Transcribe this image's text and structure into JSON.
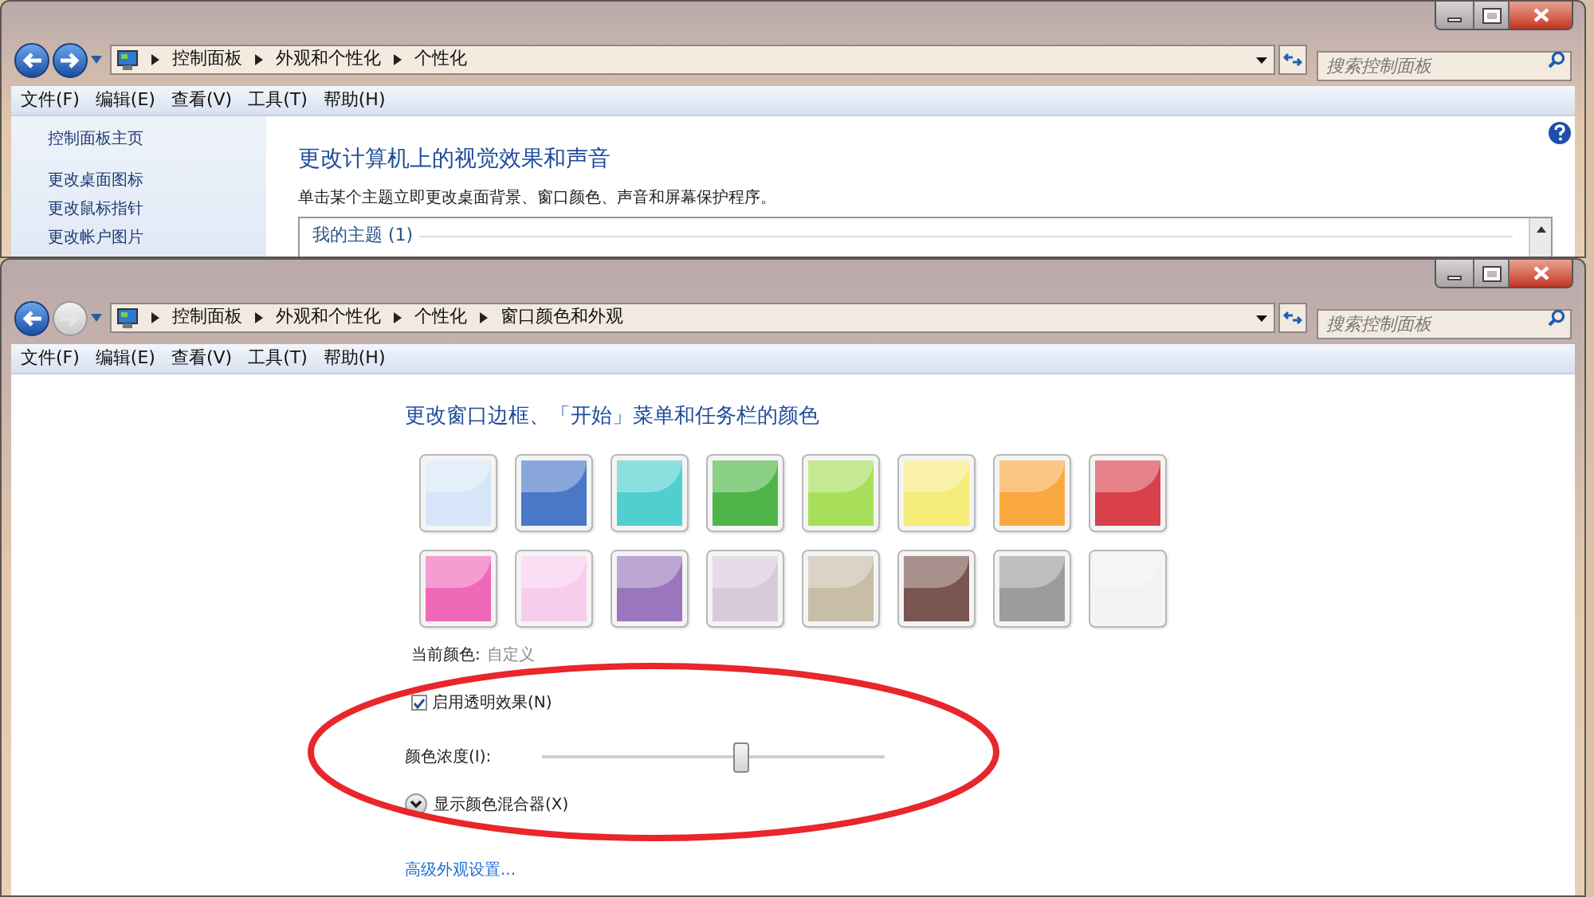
{
  "back_window": {
    "forward_enabled": true,
    "breadcrumbs": [
      "控制面板",
      "外观和个性化",
      "个性化"
    ],
    "search": {
      "placeholder": "搜索控制面板"
    },
    "menu": [
      "文件(F)",
      "编辑(E)",
      "查看(V)",
      "工具(T)",
      "帮助(H)"
    ],
    "sidebar": {
      "items": [
        "控制面板主页",
        "更改桌面图标",
        "更改鼠标指针",
        "更改帐户图片"
      ]
    },
    "heading": "更改计算机上的视觉效果和声音",
    "description": "单击某个主题立即更改桌面背景、窗口颜色、声音和屏幕保护程序。",
    "group": {
      "label": "我的主题 (1)"
    }
  },
  "front_window": {
    "forward_enabled": false,
    "breadcrumbs": [
      "控制面板",
      "外观和个性化",
      "个性化",
      "窗口颜色和外观"
    ],
    "search": {
      "placeholder": "搜索控制面板"
    },
    "menu": [
      "文件(F)",
      "编辑(E)",
      "查看(V)",
      "工具(T)",
      "帮助(H)"
    ],
    "heading": "更改窗口边框、「开始」菜单和任务栏的颜色",
    "swatches": [
      {
        "color": "#d6e6f8"
      },
      {
        "color": "#4b78c6"
      },
      {
        "color": "#4fcfcf"
      },
      {
        "color": "#4fb548"
      },
      {
        "color": "#a8df5a"
      },
      {
        "color": "#f6ec7a"
      },
      {
        "color": "#f9a83f"
      },
      {
        "color": "#d8404a"
      },
      {
        "color": "#f068b8"
      },
      {
        "color": "#f7cdee"
      },
      {
        "color": "#9a76be"
      },
      {
        "color": "#d8cadb"
      },
      {
        "color": "#c8bea8"
      },
      {
        "color": "#7a5550"
      },
      {
        "color": "#9c9c9c"
      },
      {
        "color": "#f2f2f2"
      }
    ],
    "current_color": {
      "label": "当前颜色:",
      "value": "自定义"
    },
    "transparency": {
      "label": "启用透明效果(N)",
      "checked": true
    },
    "intensity": {
      "label": "颜色浓度(I):",
      "level": 0.58
    },
    "mixer": {
      "label": "显示颜色混合器(X)",
      "expanded": false
    },
    "advanced_link": "高级外观设置..."
  }
}
